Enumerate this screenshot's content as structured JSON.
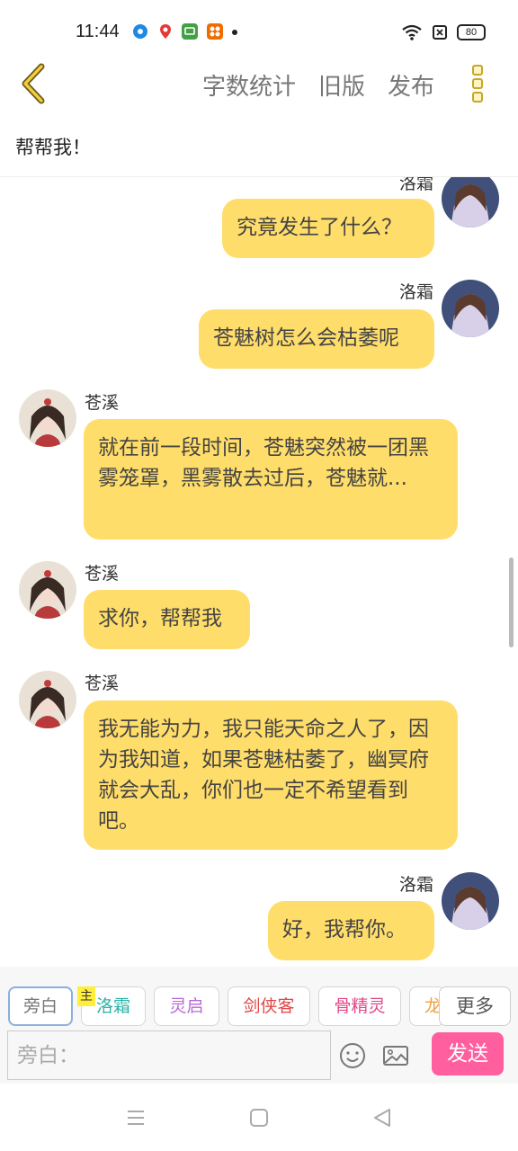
{
  "status_bar": {
    "time": "11:44",
    "battery": "80",
    "icons": [
      "browser-icon",
      "location-icon",
      "iqiyi-icon",
      "photo-app-icon",
      "notification-dot",
      "wifi-icon",
      "sim-icon",
      "battery-icon"
    ],
    "icon_colors": [
      "#1e88e5",
      "#e53935",
      "#43a047",
      "#ef6c00"
    ]
  },
  "top_bar": {
    "back_icon": "chevron-left-icon",
    "word_count": "字数统计",
    "old_version": "旧版",
    "publish": "发布",
    "menu_icon": "menu-icon",
    "accent_color": "#c9a626"
  },
  "chat": {
    "title": "帮帮我！",
    "messages": [
      {
        "side": "right",
        "sender": "洛霜",
        "text": "究竟发生了什么？"
      },
      {
        "side": "right",
        "sender": "洛霜",
        "text": "苍魅树怎么会枯萎呢"
      },
      {
        "side": "left",
        "sender": "苍溪",
        "text": "就在前一段时间，苍魅突然被一团黑雾笼罩，黑雾散去过后，苍魅就..."
      },
      {
        "side": "left",
        "sender": "苍溪",
        "text": "求你，帮帮我"
      },
      {
        "side": "left",
        "sender": "苍溪",
        "text": "我无能为力，我只能天命之人了，因为我知道，如果苍魅枯萎了，幽冥府就会大乱，你们也一定不希望看到吧。"
      },
      {
        "side": "right",
        "sender": "洛霜",
        "text": "好，我帮你。"
      }
    ],
    "bubble_color": "#ffdd6a"
  },
  "roles": {
    "main_badge": "主",
    "items": [
      {
        "label": "旁白",
        "color": "#777777"
      },
      {
        "label": "洛霜",
        "color": "#2bb3a5"
      },
      {
        "label": "灵启",
        "color": "#b86ad8"
      },
      {
        "label": "剑侠客",
        "color": "#e04848"
      },
      {
        "label": "骨精灵",
        "color": "#e0488a"
      },
      {
        "label": "龙",
        "color": "#f0a040"
      }
    ],
    "more": "更多"
  },
  "composer": {
    "placeholder": "旁白：",
    "emoji_icon": "smiley-icon",
    "image_icon": "image-icon",
    "send": "发送",
    "send_color": "#ff5f9e"
  },
  "nav": {
    "icons": [
      "menu-lines-icon",
      "home-square-icon",
      "back-triangle-icon"
    ]
  }
}
